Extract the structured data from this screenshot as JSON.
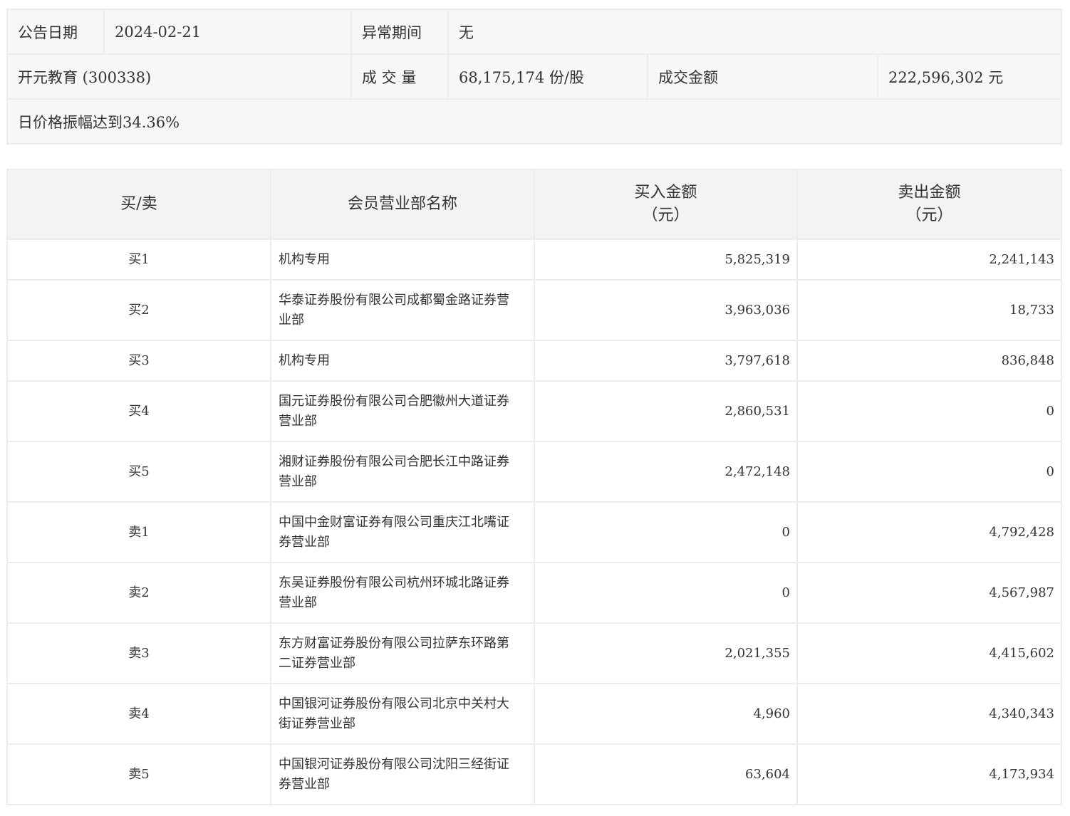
{
  "info": {
    "announce_date_label": "公告日期",
    "announce_date": "2024-02-21",
    "abnormal_period_label": "异常期间",
    "abnormal_period": "无",
    "stock": "开元教育 (300338)",
    "volume_label": "成 交 量",
    "volume": "68,175,174 份/股",
    "turnover_label": "成交金额",
    "turnover": "222,596,302 元",
    "reason": "日价格振幅达到34.36%"
  },
  "table": {
    "headers": {
      "side": "买/卖",
      "name": "会员营业部名称",
      "buy_line1": "买入金额",
      "buy_line2": "（元）",
      "sell_line1": "卖出金额",
      "sell_line2": "（元）"
    },
    "rows": [
      {
        "side": "买1",
        "name": "机构专用",
        "buy": "5,825,319",
        "sell": "2,241,143"
      },
      {
        "side": "买2",
        "name": "华泰证券股份有限公司成都蜀金路证券营业部",
        "buy": "3,963,036",
        "sell": "18,733"
      },
      {
        "side": "买3",
        "name": "机构专用",
        "buy": "3,797,618",
        "sell": "836,848"
      },
      {
        "side": "买4",
        "name": "国元证券股份有限公司合肥徽州大道证券营业部",
        "buy": "2,860,531",
        "sell": "0"
      },
      {
        "side": "买5",
        "name": "湘财证券股份有限公司合肥长江中路证券营业部",
        "buy": "2,472,148",
        "sell": "0"
      },
      {
        "side": "卖1",
        "name": "中国中金财富证券有限公司重庆江北嘴证券营业部",
        "buy": "0",
        "sell": "4,792,428"
      },
      {
        "side": "卖2",
        "name": "东吴证券股份有限公司杭州环城北路证券营业部",
        "buy": "0",
        "sell": "4,567,987"
      },
      {
        "side": "卖3",
        "name": "东方财富证券股份有限公司拉萨东环路第二证券营业部",
        "buy": "2,021,355",
        "sell": "4,415,602"
      },
      {
        "side": "卖4",
        "name": "中国银河证券股份有限公司北京中关村大街证券营业部",
        "buy": "4,960",
        "sell": "4,340,343"
      },
      {
        "side": "卖5",
        "name": "中国银河证券股份有限公司沈阳三经街证券营业部",
        "buy": "63,604",
        "sell": "4,173,934"
      }
    ]
  }
}
